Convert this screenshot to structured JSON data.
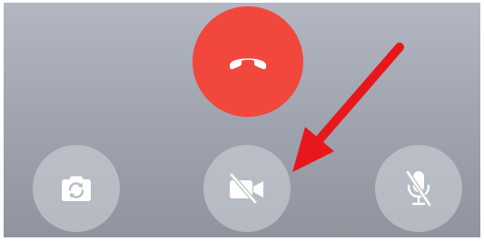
{
  "call_controls": {
    "end_call": {
      "icon": "phone-hangup-icon",
      "color": "#f2473c"
    },
    "flip_camera": {
      "icon": "camera-flip-icon"
    },
    "video_toggle": {
      "icon": "video-off-icon",
      "state": "off"
    },
    "mic_toggle": {
      "icon": "mic-off-icon",
      "state": "off"
    }
  },
  "annotation": {
    "icon": "red-arrow-icon",
    "color": "#e8171b",
    "points_to": "video_toggle"
  }
}
